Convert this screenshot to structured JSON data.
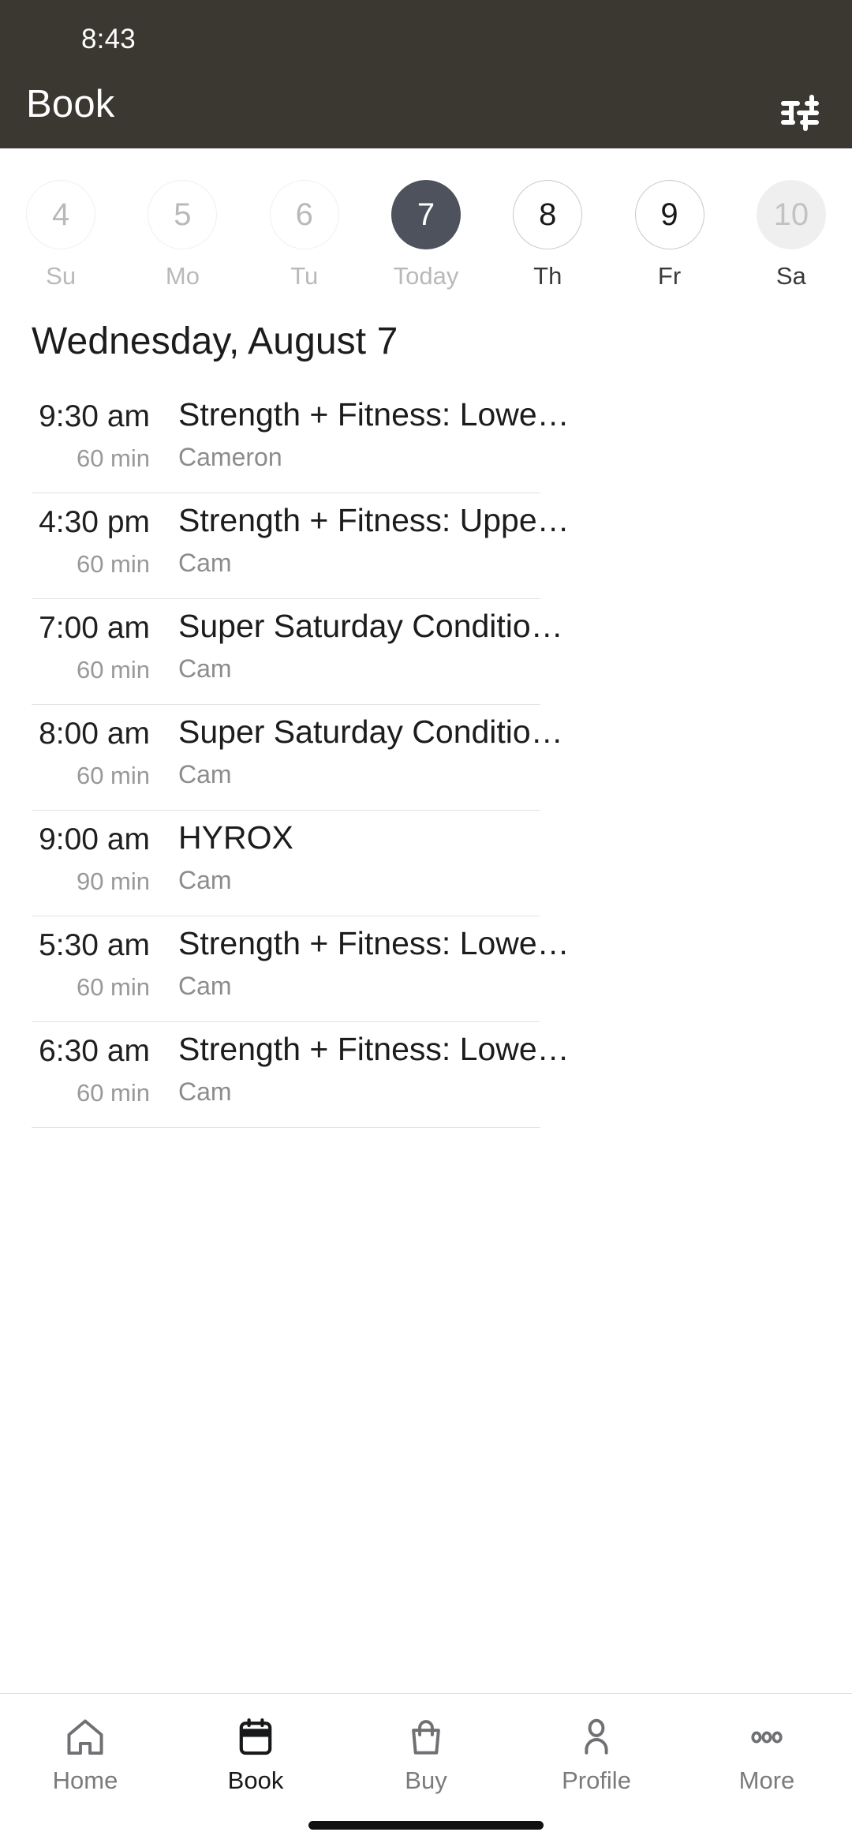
{
  "status_bar": {
    "time": "8:43"
  },
  "header": {
    "title": "Book",
    "background": "#3b3831",
    "filter_icon": "sliders-filter-icon"
  },
  "date_strip": {
    "days": [
      {
        "number": "4",
        "label": "Su",
        "state": "past"
      },
      {
        "number": "5",
        "label": "Mo",
        "state": "past"
      },
      {
        "number": "6",
        "label": "Tu",
        "state": "past"
      },
      {
        "number": "7",
        "label": "Today",
        "state": "selected"
      },
      {
        "number": "8",
        "label": "Th",
        "state": "future"
      },
      {
        "number": "9",
        "label": "Fr",
        "state": "future"
      },
      {
        "number": "10",
        "label": "Sa",
        "state": "muted"
      }
    ],
    "selected_color": "#4d525c"
  },
  "day_heading": "Wednesday, August 7",
  "classes": [
    {
      "time": "9:30 am",
      "duration": "60 min",
      "title": "Strength + Fitness: Lowe…",
      "instructor": "Cameron"
    },
    {
      "time": "4:30 pm",
      "duration": "60 min",
      "title": "Strength + Fitness: Uppe…",
      "instructor": "Cam"
    },
    {
      "time": "7:00 am",
      "duration": "60 min",
      "title": "Super Saturday Conditio…",
      "instructor": "Cam"
    },
    {
      "time": "8:00 am",
      "duration": "60 min",
      "title": "Super Saturday Conditio…",
      "instructor": "Cam"
    },
    {
      "time": "9:00 am",
      "duration": "90 min",
      "title": "HYROX",
      "instructor": "Cam"
    },
    {
      "time": "5:30 am",
      "duration": "60 min",
      "title": "Strength + Fitness: Lowe…",
      "instructor": "Cam"
    },
    {
      "time": "6:30 am",
      "duration": "60 min",
      "title": "Strength + Fitness: Lowe…",
      "instructor": "Cam"
    }
  ],
  "tab_bar": {
    "items": [
      {
        "label": "Home",
        "icon": "home-icon",
        "active": false
      },
      {
        "label": "Book",
        "icon": "calendar-icon",
        "active": true
      },
      {
        "label": "Buy",
        "icon": "shopping-bag-icon",
        "active": false
      },
      {
        "label": "Profile",
        "icon": "person-icon",
        "active": false
      },
      {
        "label": "More",
        "icon": "ellipsis-icon",
        "active": false
      }
    ]
  }
}
